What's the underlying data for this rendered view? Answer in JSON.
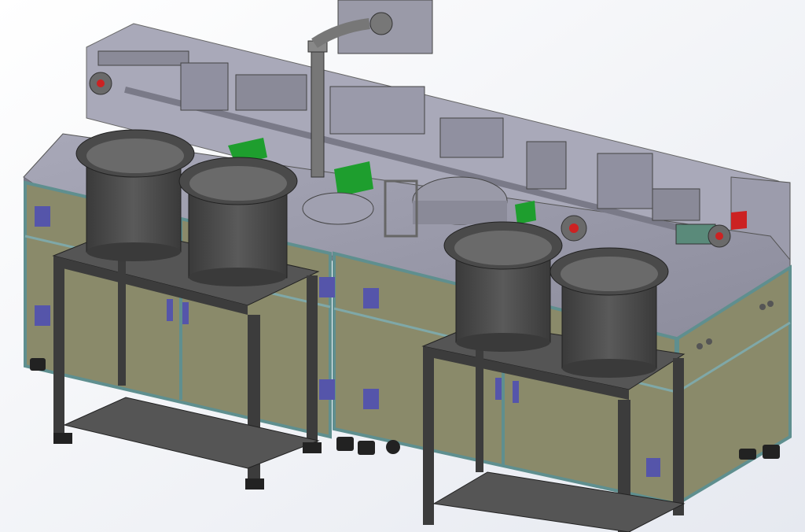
{
  "scene": {
    "description_label": "",
    "colors": {
      "background": "#f2f4f8",
      "table_top": "#9a9aa8",
      "table_top_light": "#b4b4c2",
      "cabinet_panel": "#8a8a6a",
      "frame_profile": "#7fa8a8",
      "stand": "#555555",
      "stand_dark": "#3c3c3c",
      "bowl": "#4a4a4a",
      "bowl_inner": "#6a6a6a",
      "accent_green": "#1e9e2e",
      "accent_red": "#cc2222",
      "hinge": "#5555aa"
    },
    "icons": [
      "hinge-icon",
      "bowl-feeder",
      "robot-arm"
    ]
  }
}
